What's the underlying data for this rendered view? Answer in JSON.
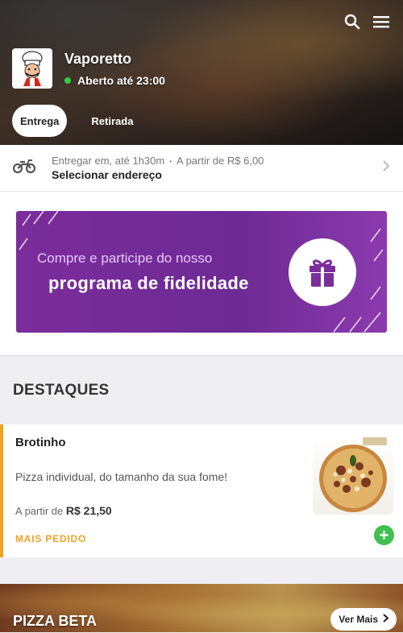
{
  "header": {
    "store_name": "Vaporetto",
    "status": "Aberto até 23:00",
    "status_color": "#2ecc40",
    "icons": [
      "search-icon",
      "menu-icon"
    ]
  },
  "modes": [
    {
      "label": "Entrega",
      "active": true
    },
    {
      "label": "Retirada",
      "active": false
    }
  ],
  "delivery": {
    "line1_left": "Entregar em, até 1h30m",
    "separator": "•",
    "line1_right": "A partir de R$ 6,00",
    "address": "Selecionar endereço"
  },
  "loyalty": {
    "line1": "Compre e participe do nosso",
    "line2": "programa de fidelidade",
    "accent": "#7a2d9b"
  },
  "highlights": {
    "title": "DESTAQUES",
    "item": {
      "name": "Brotinho",
      "description": "Pizza individual, do tamanho da sua fome!",
      "price_prefix": "A partir de",
      "price": "R$ 21,50",
      "badge": "MAIS PEDIDO",
      "add_label": "+"
    }
  },
  "category": {
    "title": "PIZZA BETA",
    "more_label": "Ver Mais"
  }
}
